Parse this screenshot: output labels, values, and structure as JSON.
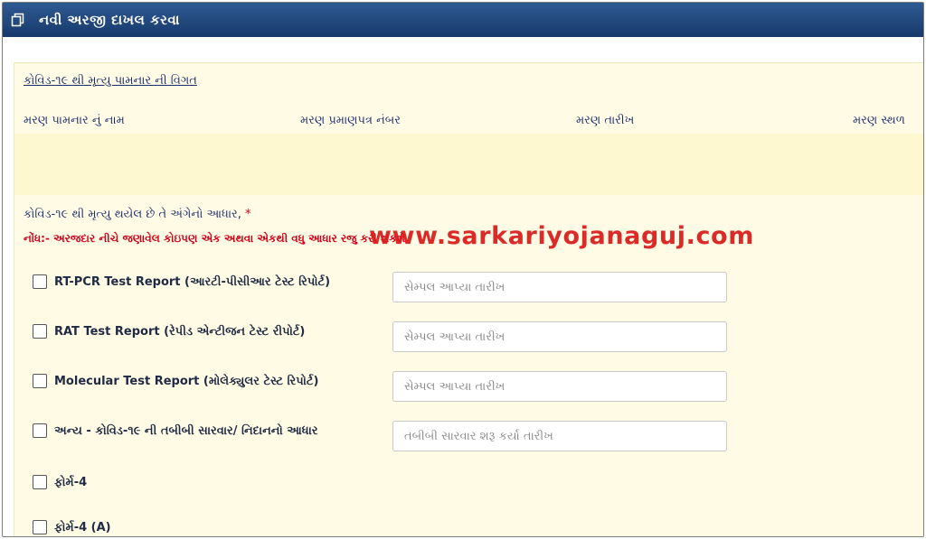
{
  "header": {
    "title": "નવી અરજી દાખલ કરવા",
    "icon": "copy-icon"
  },
  "deceased_section": {
    "title": "કોવિડ-૧૯ થી મૃત્યુ પામનાર ની વિગત",
    "columns": [
      "મરણ પામનાર નું નામ",
      "મરણ પ્રમાણપત્ર નંબર",
      "મરણ તારીખ",
      "મરણ સ્થળ"
    ]
  },
  "basis": {
    "label": "કોવિડ-૧૯ થી મૃત્યુ થયેલ છે તે અંગેનો આધાર,",
    "required_mark": "*",
    "note": "નોંધ:- અરજદાર નીચે જણાવેલ કોઇપણ એક અથવા એકથી વધુ આધાર રજુ કરી શકશે"
  },
  "watermark": "www.sarkariyojanaguj.com",
  "options": [
    {
      "label": "RT-PCR Test Report (આરટી-પીસીઆર ટેસ્ટ રિપોર્ટ)",
      "checked": false,
      "date_placeholder": "સેમ્પલ આપ્યા તારીખ"
    },
    {
      "label": "RAT Test Report (રેપીડ એન્ટીજન ટેસ્ટ રીપોર્ટ)",
      "checked": false,
      "date_placeholder": "સેમ્પલ આપ્યા તારીખ"
    },
    {
      "label": "Molecular Test Report (મોલેક્યુલર ટેસ્ટ રિપોર્ટ)",
      "checked": false,
      "date_placeholder": "સેમ્પલ આપ્યા તારીખ"
    },
    {
      "label": "અન્ય - કોવિડ-૧૯ ની તબીબી સારવાર/ નિદાનનો આધાર",
      "checked": false,
      "date_placeholder": "તબીબી સારવાર શરૂ કર્યા તારીખ"
    },
    {
      "label": "ફોર્મ-4",
      "checked": false
    },
    {
      "label": "ફોર્મ-4 (A)",
      "checked": false
    }
  ]
}
